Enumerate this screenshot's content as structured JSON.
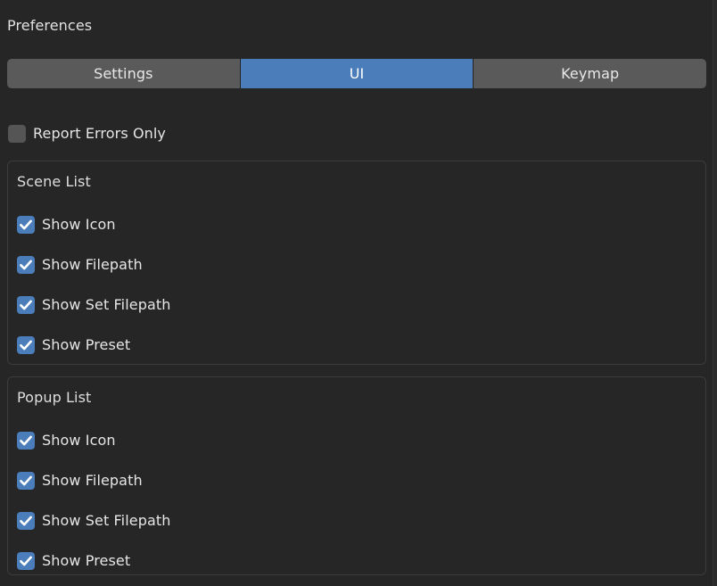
{
  "window": {
    "title": "Preferences",
    "background_color": "#262626",
    "text_color": "#e6e6e6"
  },
  "tabs": {
    "selected_index": 1,
    "accent_color": "#4a7dba",
    "inactive_color": "#5a5a5a",
    "items": [
      {
        "label": "Settings",
        "selected": false
      },
      {
        "label": "UI",
        "selected": true
      },
      {
        "label": "Keymap",
        "selected": false
      }
    ]
  },
  "top_options": [
    {
      "label": "Report Errors Only",
      "checked": false
    }
  ],
  "groups": [
    {
      "title": "Scene List",
      "items": [
        {
          "label": "Show Icon",
          "checked": true
        },
        {
          "label": "Show Filepath",
          "checked": true
        },
        {
          "label": "Show Set Filepath",
          "checked": true
        },
        {
          "label": "Show Preset",
          "checked": true
        }
      ]
    },
    {
      "title": "Popup List",
      "items": [
        {
          "label": "Show Icon",
          "checked": true
        },
        {
          "label": "Show Filepath",
          "checked": true
        },
        {
          "label": "Show Set Filepath",
          "checked": true
        },
        {
          "label": "Show Preset",
          "checked": true
        }
      ]
    }
  ],
  "icons": {
    "checkmark": "check-icon"
  }
}
